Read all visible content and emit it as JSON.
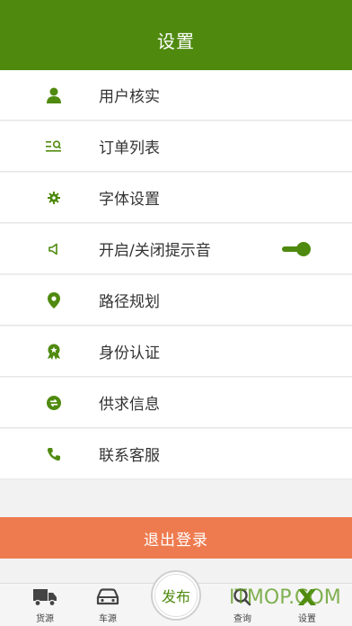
{
  "header": {
    "title": "设置"
  },
  "settings": {
    "items": [
      {
        "label": "用户核实",
        "icon": "user-icon"
      },
      {
        "label": "订单列表",
        "icon": "order-list-icon"
      },
      {
        "label": "字体设置",
        "icon": "gear-icon"
      },
      {
        "label": "开启/关闭提示音",
        "icon": "speaker-icon",
        "toggle_on": true
      },
      {
        "label": "路径规划",
        "icon": "location-pin-icon"
      },
      {
        "label": "身份认证",
        "icon": "badge-icon"
      },
      {
        "label": "供求信息",
        "icon": "exchange-icon"
      },
      {
        "label": "联系客服",
        "icon": "phone-icon"
      }
    ]
  },
  "logout": {
    "label": "退出登录"
  },
  "tabbar": {
    "tabs": [
      {
        "label": "货源",
        "icon": "truck-icon"
      },
      {
        "label": "车源",
        "icon": "car-icon"
      },
      {
        "label": "查询",
        "icon": "search-icon"
      },
      {
        "label": "设置",
        "icon": "settings-icon",
        "active": true
      }
    ],
    "publish_label": "发布"
  },
  "watermark": "ITMOP.COM",
  "colors": {
    "brand_green": "#4f8a0f",
    "logout_orange": "#ee7b4f"
  }
}
